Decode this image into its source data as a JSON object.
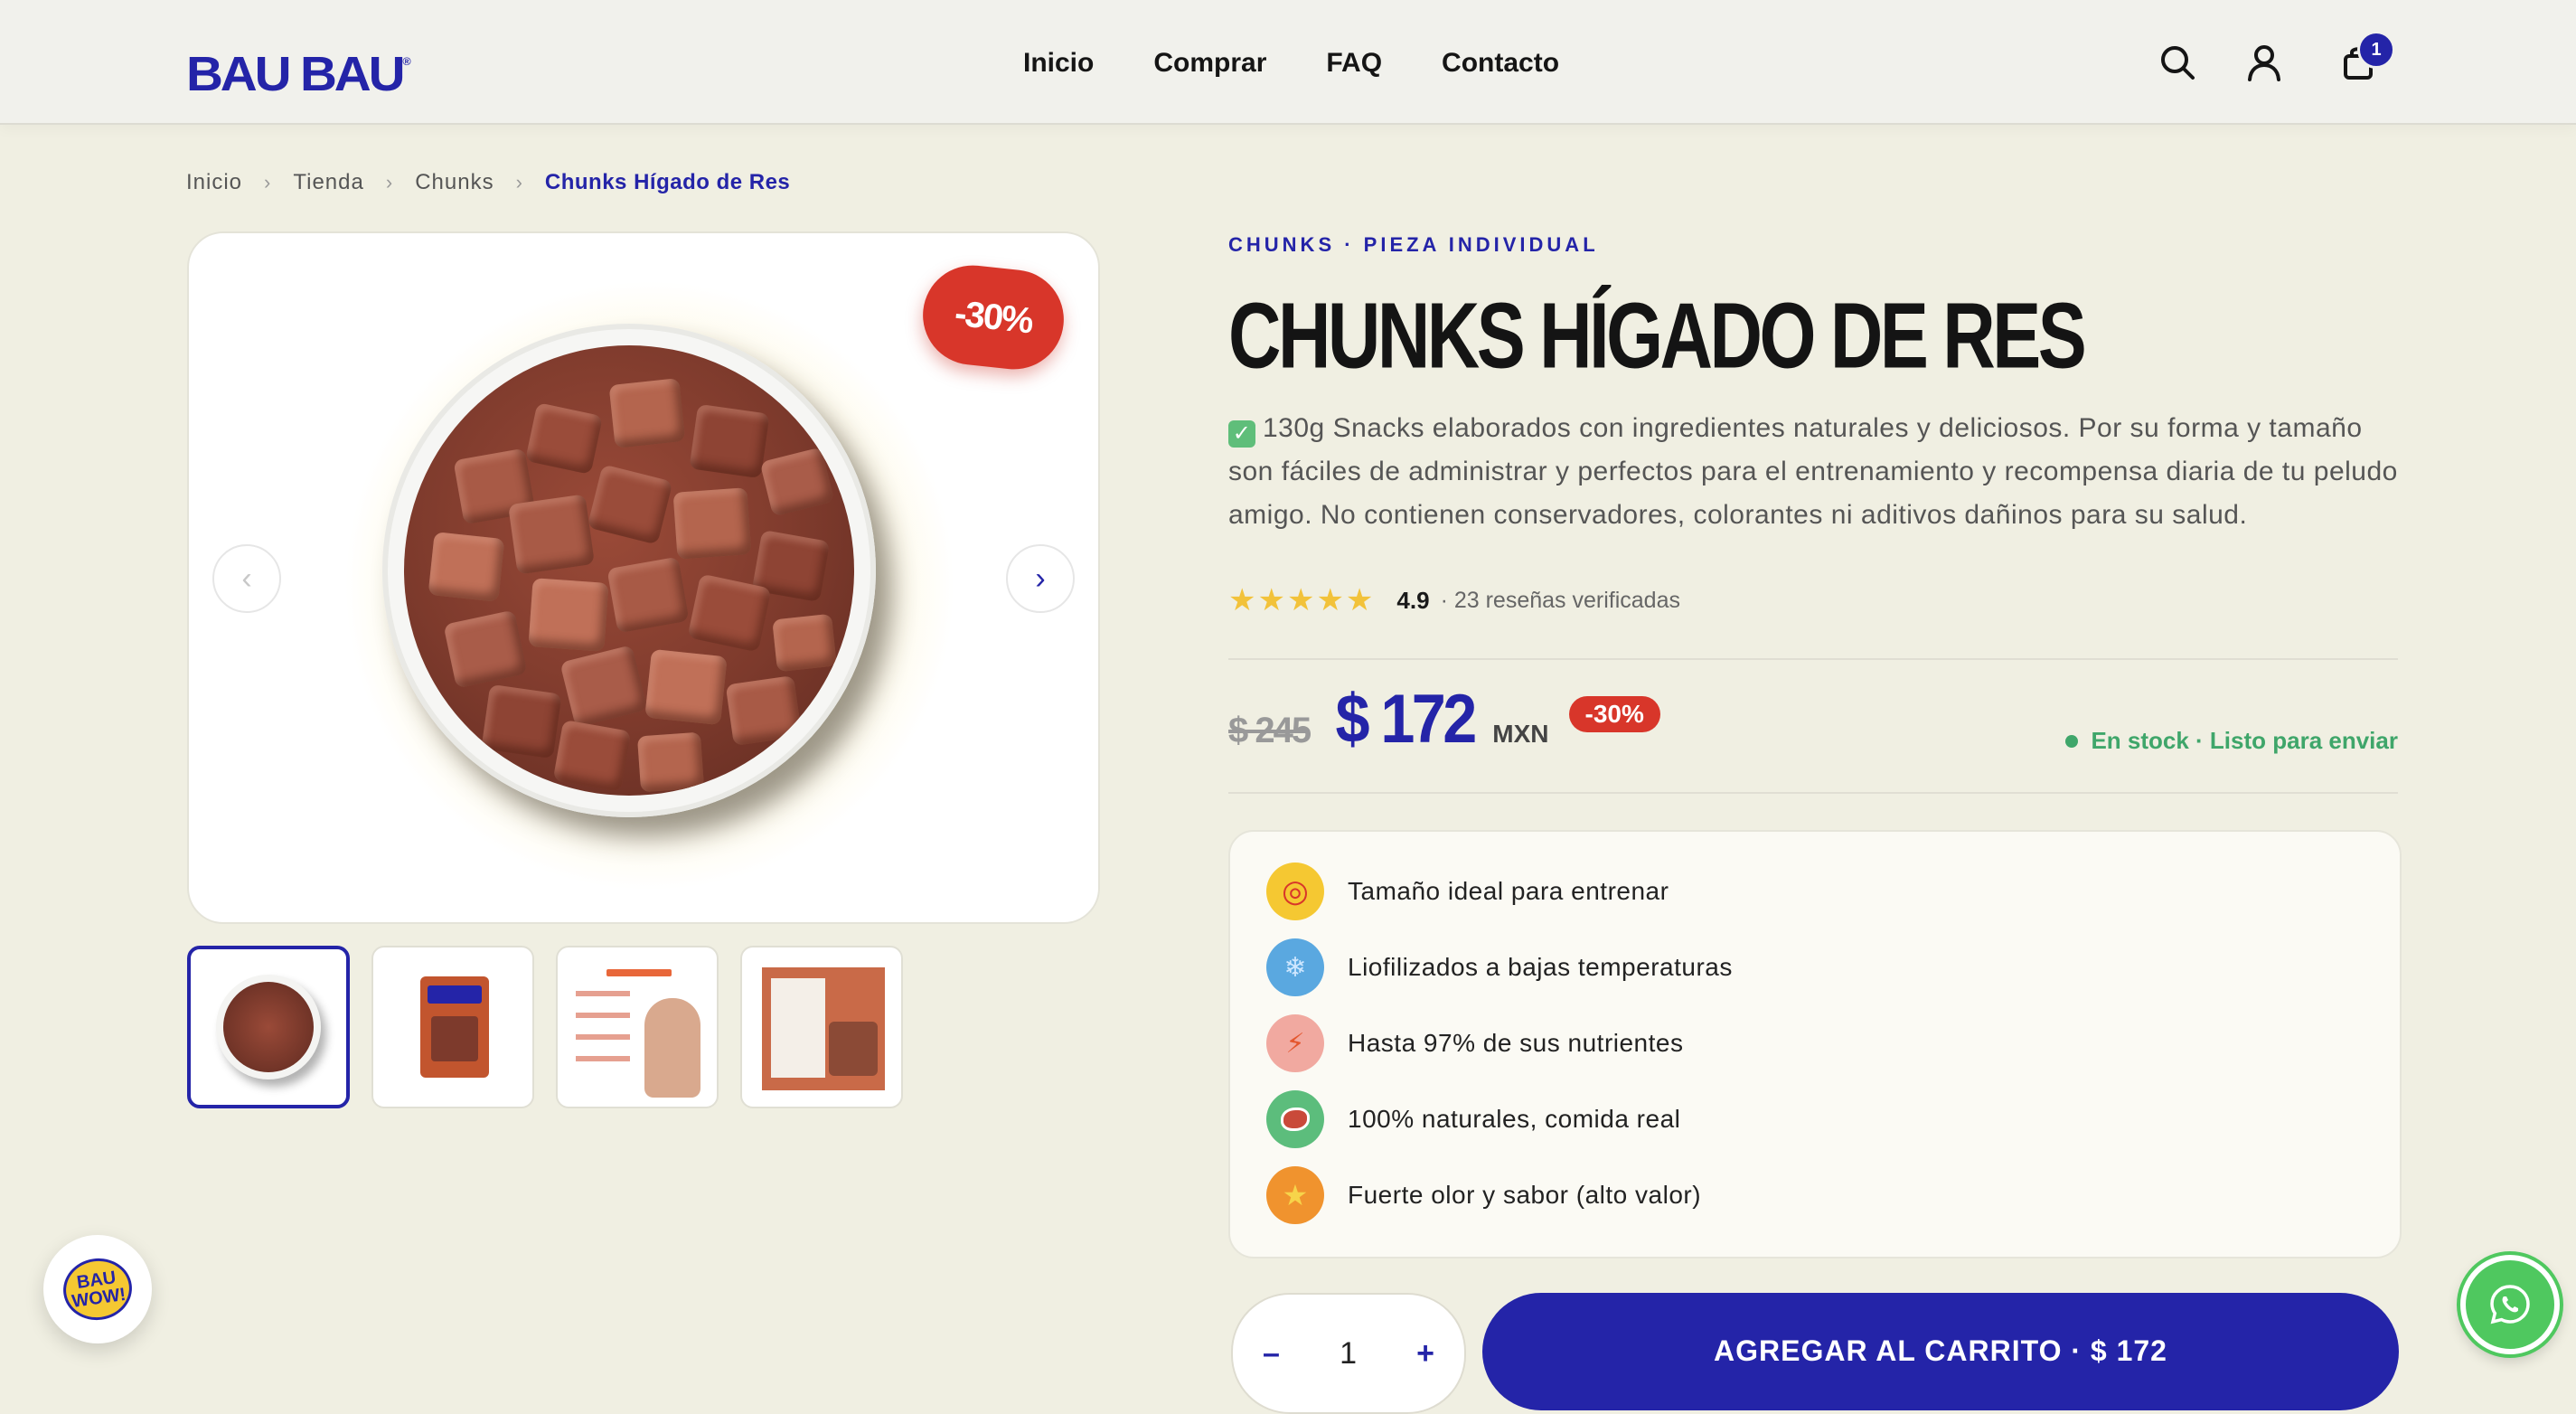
{
  "header": {
    "logo": "BAU BAU",
    "nav": [
      "Inicio",
      "Comprar",
      "FAQ",
      "Contacto"
    ],
    "cart_count": "1"
  },
  "breadcrumb": [
    "Inicio",
    "Tienda",
    "Chunks",
    "Chunks Hígado de Res"
  ],
  "gallery": {
    "discount_tag": "-30%",
    "prev": "‹",
    "next": "›"
  },
  "product": {
    "category": "CHUNKS · PIEZA INDIVIDUAL",
    "title": "CHUNKS HÍGADO DE RES",
    "description": "130g Snacks elaborados con ingredientes naturales y deliciosos. Por su forma y tamaño son fáciles de administrar y perfectos para el entrenamiento y recompensa diaria de tu peludo amigo. No contienen conservadores, colorantes ni aditivos dañinos para su salud.",
    "rating_stars": "★★★★★",
    "rating": "4.9",
    "reviews": "· 23 reseñas verificadas",
    "old_price": "$ 245",
    "price": "$ 172",
    "currency": "MXN",
    "discount": "-30%",
    "stock": "En stock · Listo para enviar"
  },
  "features": [
    {
      "label": "Tamaño ideal para entrenar",
      "icon": "target-icon",
      "color": "#f5c832",
      "glyph": "◎"
    },
    {
      "label": "Liofilizados a bajas temperaturas",
      "icon": "snowflake-icon",
      "color": "#5aa8e0",
      "glyph": "❄"
    },
    {
      "label": "Hasta 97% de sus nutrientes",
      "icon": "lightning-icon",
      "color": "#f1a9a0",
      "glyph": "⚡"
    },
    {
      "label": "100% naturales, comida real",
      "icon": "meat-icon",
      "color": "#5cbd7c",
      "glyph": "●"
    },
    {
      "label": "Fuerte olor y sabor (alto valor)",
      "icon": "star-icon",
      "color": "#f0932e",
      "glyph": "★"
    }
  ],
  "purchase": {
    "minus": "–",
    "quantity": "1",
    "plus": "+",
    "add_to_cart": "AGREGAR AL CARRITO ·  $ 172"
  },
  "widgets": {
    "bauwow": "BAU WOW!"
  },
  "colors": {
    "brand": "#2424a8",
    "discount": "#d8362a",
    "stock": "#3fa66a",
    "background": "#f0efe2"
  }
}
